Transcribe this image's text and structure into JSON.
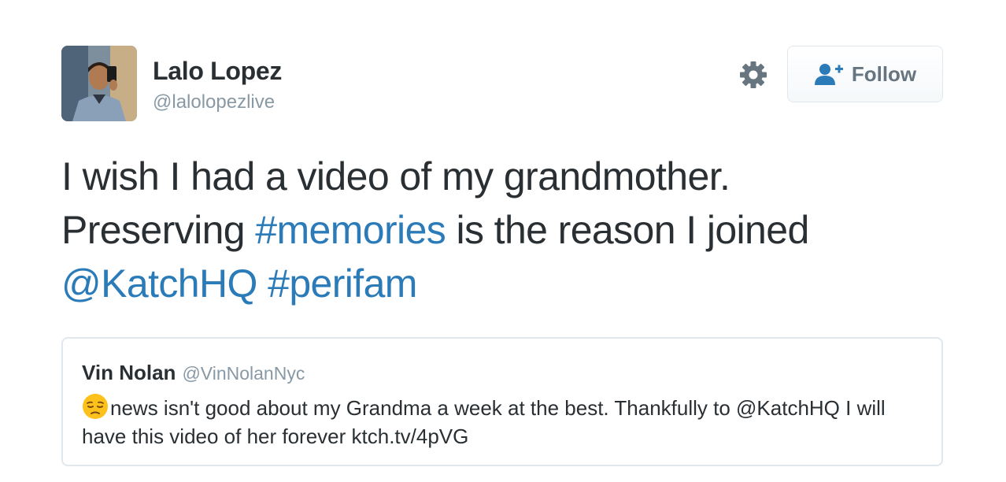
{
  "author": {
    "name": "Lalo Lopez",
    "handle": "@lalolopezlive"
  },
  "actions": {
    "follow_label": "Follow",
    "settings_icon": "gear-icon",
    "follow_icon": "add-user-icon"
  },
  "tweet": {
    "line1": "I wish I had a video of my grandmother.",
    "line2_pre": "Preserving ",
    "line2_hashtag": "#memories",
    "line2_post": " is the reason I joined",
    "line3_mention": "@KatchHQ",
    "line3_sep": " ",
    "line3_hashtag": "#perifam"
  },
  "quoted_tweet": {
    "name": "Vin Nolan",
    "handle": "@VinNolanNyc",
    "emoji": "pensive-face-emoji",
    "text": "news isn't good about my Grandma a week at the best. Thankfully to @KatchHQ I will have this video of her forever ktch.tv/4pVG"
  },
  "colors": {
    "link": "#2b7bb9",
    "text": "#292f33",
    "muted": "#8899a6",
    "border": "#e1e8ed",
    "icon": "#66757f"
  }
}
